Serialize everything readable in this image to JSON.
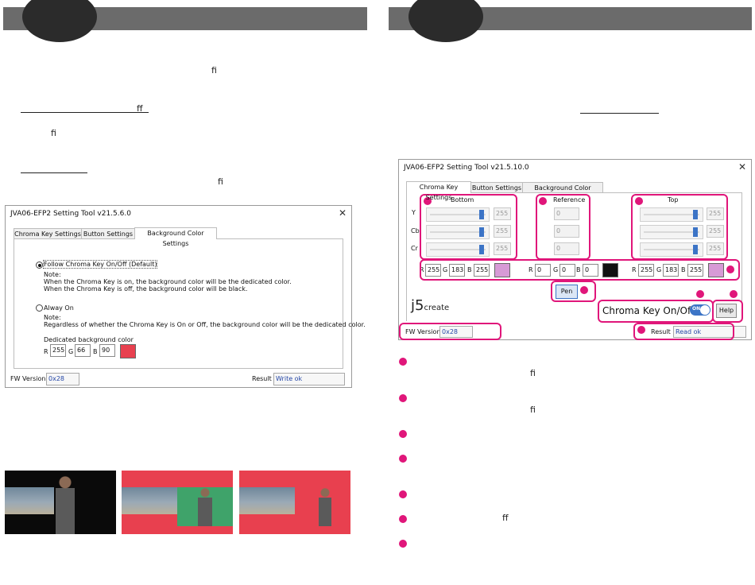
{
  "left": {
    "glyphs": {
      "fi1": "fi",
      "ff1": "ff",
      "fi2": "fi",
      "fi3": "fi"
    },
    "window": {
      "title": "JVA06-EFP2 Setting Tool v21.5.6.0",
      "close": "✕",
      "tabs": [
        "Chroma Key Settings",
        "Button Settings",
        "Background Color Settings"
      ],
      "option1": {
        "label": "Follow Chroma Key On/Off (Default)",
        "note": "Note:",
        "line1": "When the Chroma Key is on, the background color will be the dedicated color.",
        "line2": "When the Chroma Key is off, the background color will be black."
      },
      "option2": {
        "label": "Alway On",
        "note": "Note:",
        "line1": "Regardless of whether the Chroma Key is On or Off, the background color will be the dedicated color."
      },
      "dedicated": {
        "label": "Dedicated background color",
        "r_label": "R",
        "r": "255",
        "g_label": "G",
        "g": "66",
        "b_label": "B",
        "b": "90",
        "swatch_color": "#e8404f"
      },
      "fw_label": "FW Version :",
      "fw_value": "0x28",
      "result_label": "Result :",
      "result_value": "Write ok"
    }
  },
  "right": {
    "window": {
      "title": "JVA06-EFP2 Setting Tool v21.5.10.0",
      "close": "✕",
      "tabs": [
        "Chroma Key Settings",
        "Button Settings",
        "Background Color Settings"
      ],
      "groups": {
        "bottom": "Bottom",
        "reference": "Reference",
        "top": "Top"
      },
      "rows": [
        "Y",
        "Cb",
        "Cr"
      ],
      "bottom_vals": [
        "255",
        "255",
        "255"
      ],
      "reference_vals": [
        "0",
        "0",
        "0"
      ],
      "top_vals": [
        "255",
        "255",
        "255"
      ],
      "rgb": [
        {
          "r_label": "R",
          "r": "255",
          "g_label": "G",
          "g": "183",
          "b_label": "B",
          "b": "255",
          "color": "#d79ad6"
        },
        {
          "r_label": "R",
          "r": "0",
          "g_label": "G",
          "g": "0",
          "b_label": "B",
          "b": "0",
          "color": "#111111"
        },
        {
          "r_label": "R",
          "r": "255",
          "g_label": "G",
          "g": "183",
          "b_label": "B",
          "b": "255",
          "color": "#d79ad6"
        }
      ],
      "pen_label": "Pen",
      "brand_main": "j5",
      "brand_sub": "create",
      "chroma_label": "Chroma Key On/Off",
      "toggle_label": "ON",
      "help_label": "Help",
      "fw_label": "FW Version :",
      "fw_value": "0x28",
      "result_label": "Result :",
      "result_value": "Read ok"
    },
    "glyphs": {
      "fi1": "fi",
      "fi2": "fi",
      "ff1": "ff"
    }
  },
  "colors": {
    "accent": "#e0167a",
    "toggle": "#3c74c6"
  }
}
